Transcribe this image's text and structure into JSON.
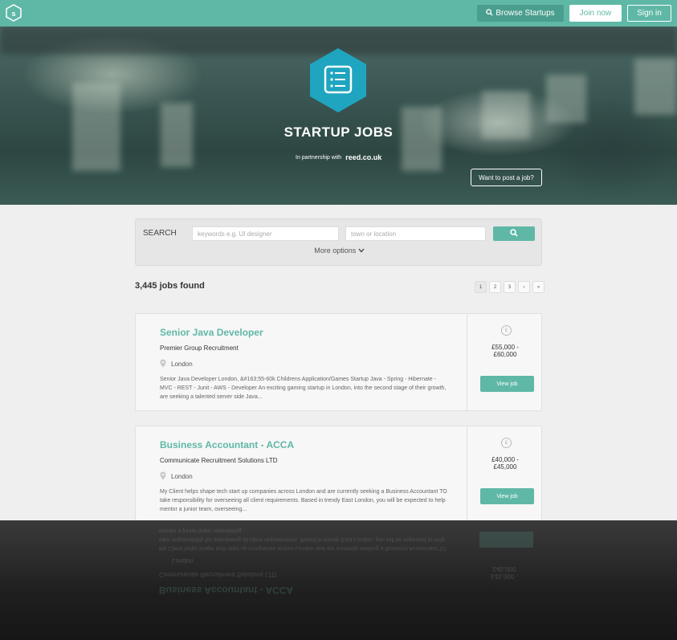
{
  "nav": {
    "logo_text": "s",
    "browse_label": "Browse Startups",
    "join_label": "Join now",
    "signin_label": "Sign in"
  },
  "hero": {
    "title": "STARTUP JOBS",
    "partner_text": "In partnership with",
    "partner_brand": "reed.co.uk",
    "post_job_label": "Want to post a job?"
  },
  "search": {
    "label": "SEARCH",
    "keywords_placeholder": "keywords e.g. UI designer",
    "location_placeholder": "town or location",
    "more_options_label": "More options"
  },
  "results": {
    "count_text": "3,445 jobs found",
    "pages": [
      "1",
      "2",
      "3",
      "›",
      "»"
    ]
  },
  "jobs": [
    {
      "title": "Senior Java Developer",
      "company": "Premier Group Recruitment",
      "location": "London",
      "description": "Senior Java Developer London, &#163;55-60k Childrens Application/Games Startup Java - Spring - Hibernate - MVC - REST - Junit - AWS - Developer An exciting gaming startup in London, into the second stage of their growth, are seeking a talented server side Java...",
      "currency_symbol": "£",
      "salary_low": "£55,000 -",
      "salary_high": "£60,000",
      "view_label": "View job"
    },
    {
      "title": "Business Accountant - ACCA",
      "company": "Communicate Recruitment Solutions LTD",
      "location": "London",
      "description": "My Client helps shape tech start up companies across London and are currently seeking a Business Accountant TO take responsibility for overseeing all client requirements. Based in trendy East London, you will be expected to help mentor a junior team, overseeing...",
      "currency_symbol": "£",
      "salary_low": "£40,000 -",
      "salary_high": "£45,000",
      "view_label": "View job"
    }
  ],
  "colors": {
    "accent": "#5fb8a5",
    "hex_icon": "#1fa5c0"
  }
}
